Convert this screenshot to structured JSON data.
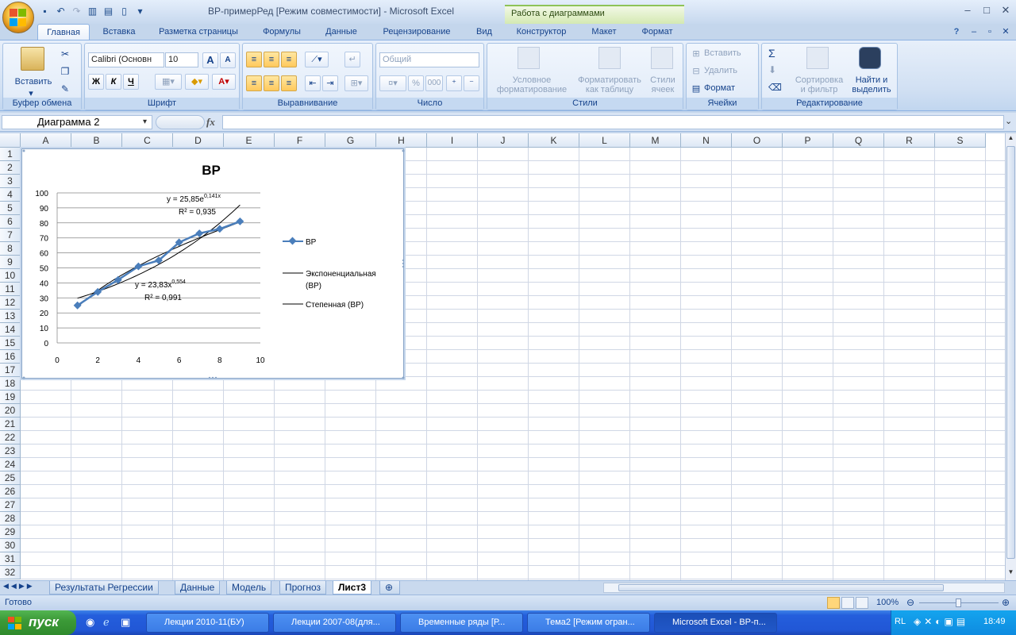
{
  "window": {
    "title": "ВР-примерРед  [Режим совместимости] - Microsoft Excel",
    "context_title": "Работа с диаграммами",
    "min": "–",
    "max": "□",
    "close": "✕"
  },
  "ribbon_tabs": [
    "Главная",
    "Вставка",
    "Разметка страницы",
    "Формулы",
    "Данные",
    "Рецензирование",
    "Вид",
    "Конструктор",
    "Макет",
    "Формат"
  ],
  "ribbon": {
    "clipboard": {
      "label": "Буфер обмена",
      "paste": "Вставить"
    },
    "font": {
      "label": "Шрифт",
      "name": "Calibri (Основн",
      "size": "10",
      "bold": "Ж",
      "italic": "К",
      "underline": "Ч",
      "grow": "A",
      "shrink": "A"
    },
    "alignment": {
      "label": "Выравнивание"
    },
    "number": {
      "label": "Число",
      "format": "Общий",
      "percent": "%",
      "thousands": "000"
    },
    "styles": {
      "label": "Стили",
      "conditional": "Условное\nформатирование",
      "as_table": "Форматировать\nкак таблицу",
      "cell_styles": "Стили\nячеек"
    },
    "cells": {
      "label": "Ячейки",
      "insert": "Вставить",
      "delete": "Удалить",
      "format": "Формат"
    },
    "editing": {
      "label": "Редактирование",
      "sort": "Сортировка\nи фильтр",
      "find": "Найти и\nвыделить"
    }
  },
  "formula_bar": {
    "name_box": "Диаграмма 2",
    "fx": "fx"
  },
  "columns": [
    "A",
    "B",
    "C",
    "D",
    "E",
    "F",
    "G",
    "H",
    "I",
    "J",
    "K",
    "L",
    "M",
    "N",
    "O",
    "P",
    "Q",
    "R",
    "S"
  ],
  "rows": [
    "1",
    "2",
    "3",
    "4",
    "5",
    "6",
    "7",
    "8",
    "9",
    "10",
    "11",
    "12",
    "13",
    "14",
    "15",
    "16",
    "17",
    "18",
    "19",
    "20",
    "21",
    "22",
    "23",
    "24",
    "25",
    "26",
    "27",
    "28",
    "29",
    "30",
    "31",
    "32"
  ],
  "chart_data": {
    "type": "line",
    "title": "ВР",
    "x": [
      1,
      2,
      3,
      4,
      5,
      6,
      7,
      8,
      9
    ],
    "series": [
      {
        "name": "ВР",
        "values": [
          25,
          34,
          42,
          51,
          55,
          67,
          73,
          76,
          81
        ],
        "color": "#4a7ebb"
      }
    ],
    "trendlines": [
      {
        "name": "Экспоненциальная (ВР)",
        "equation": "y = 25,85e",
        "equation_exp": "0,141x",
        "r2_label": "R",
        "r2_value": "² = 0,935"
      },
      {
        "name": "Степенная (ВР)",
        "equation": "y = 23,83x",
        "equation_exp": "0,554",
        "r2_label": "R",
        "r2_value": "² = 0,991"
      }
    ],
    "xlim": [
      0,
      10
    ],
    "ylim": [
      0,
      100
    ],
    "x_ticks": [
      "0",
      "2",
      "4",
      "6",
      "8",
      "10"
    ],
    "y_ticks": [
      "0",
      "10",
      "20",
      "30",
      "40",
      "50",
      "60",
      "70",
      "80",
      "90",
      "100"
    ],
    "grid": true,
    "legend": "right"
  },
  "sheet_tabs": [
    "Результаты Регрессии",
    "Данные",
    "Модель",
    "Прогноз",
    "Лист3"
  ],
  "active_sheet": "Лист3",
  "status": {
    "ready": "Готово",
    "zoom": "100%"
  },
  "taskbar": {
    "start": "пуск",
    "tasks": [
      "Лекции 2010-11(БУ)",
      "Лекции 2007-08(для...",
      "Временные ряды [Р...",
      "Тема2 [Режим огран...",
      "Microsoft Excel - ВР-п..."
    ],
    "lang": "RL",
    "clock": "18:49"
  }
}
